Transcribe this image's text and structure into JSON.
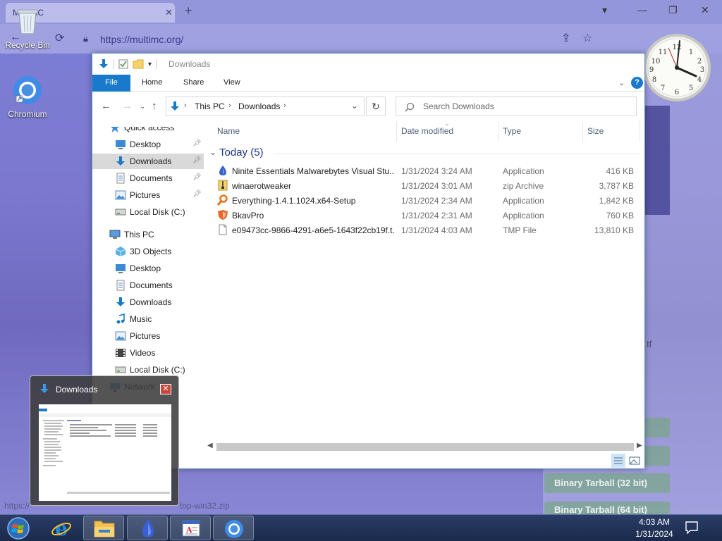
{
  "browser": {
    "tab_title": "MultiMC",
    "url": "https://multimc.org/",
    "status_url": "https://",
    "status_url_tail": "top-win32.zip",
    "buttons": [
      "Binary Tarball (32 bit)",
      "Binary Tarball (64 bit)"
    ],
    "partial_text": "If"
  },
  "desktop": {
    "icons": [
      {
        "label": "Recycle Bin",
        "icon": "recycle-bin-icon"
      },
      {
        "label": "Chromium",
        "icon": "chromium-icon"
      }
    ]
  },
  "explorer": {
    "title": "Downloads",
    "ribbon_tabs": [
      "File",
      "Home",
      "Share",
      "View"
    ],
    "breadcrumb": [
      "This PC",
      "Downloads"
    ],
    "search_placeholder": "Search Downloads",
    "columns": [
      "Name",
      "Date modified",
      "Type",
      "Size"
    ],
    "group": "Today (5)",
    "nav": [
      {
        "label": "Quick access",
        "icon": "star-icon",
        "level": 0,
        "pinned": false
      },
      {
        "label": "Desktop",
        "icon": "desktop-folder-icon",
        "level": 1,
        "pinned": true
      },
      {
        "label": "Downloads",
        "icon": "downloads-icon",
        "level": 1,
        "pinned": true,
        "selected": true
      },
      {
        "label": "Documents",
        "icon": "documents-icon",
        "level": 1,
        "pinned": true
      },
      {
        "label": "Pictures",
        "icon": "pictures-icon",
        "level": 1,
        "pinned": true
      },
      {
        "label": "Local Disk (C:)",
        "icon": "drive-icon",
        "level": 1,
        "pinned": false
      },
      {
        "label": "This PC",
        "icon": "computer-icon",
        "level": 0,
        "pinned": false
      },
      {
        "label": "3D Objects",
        "icon": "3d-objects-icon",
        "level": 1,
        "pinned": false
      },
      {
        "label": "Desktop",
        "icon": "desktop-folder-icon",
        "level": 1,
        "pinned": false
      },
      {
        "label": "Documents",
        "icon": "documents-icon",
        "level": 1,
        "pinned": false
      },
      {
        "label": "Downloads",
        "icon": "downloads-icon",
        "level": 1,
        "pinned": false
      },
      {
        "label": "Music",
        "icon": "music-icon",
        "level": 1,
        "pinned": false
      },
      {
        "label": "Pictures",
        "icon": "pictures-icon",
        "level": 1,
        "pinned": false
      },
      {
        "label": "Videos",
        "icon": "videos-icon",
        "level": 1,
        "pinned": false
      },
      {
        "label": "Local Disk (C:)",
        "icon": "drive-icon",
        "level": 1,
        "pinned": false
      },
      {
        "label": "Network",
        "icon": "network-icon",
        "level": 0,
        "pinned": false
      }
    ],
    "files": [
      {
        "name": "Ninite Essentials Malwarebytes Visual Stu...",
        "date": "1/31/2024 3:24 AM",
        "type": "Application",
        "size": "416 KB",
        "icon": "ninite-icon"
      },
      {
        "name": "winaerotweaker",
        "date": "1/31/2024 3:01 AM",
        "type": "zip Archive",
        "size": "3,787 KB",
        "icon": "zip-archive-icon"
      },
      {
        "name": "Everything-1.4.1.1024.x64-Setup",
        "date": "1/31/2024 2:34 AM",
        "type": "Application",
        "size": "1,842 KB",
        "icon": "everything-search-icon"
      },
      {
        "name": "BkavPro",
        "date": "1/31/2024 2:31 AM",
        "type": "Application",
        "size": "760 KB",
        "icon": "bkav-shield-icon"
      },
      {
        "name": "e09473cc-9866-4291-a6e5-1643f22cb19f.t...",
        "date": "1/31/2024 4:03 AM",
        "type": "TMP File",
        "size": "13,810 KB",
        "icon": "blank-file-icon"
      }
    ]
  },
  "thumbnail": {
    "title": "Downloads"
  },
  "taskbar": {
    "items": [
      "start-orb-icon",
      "internet-explorer-icon",
      "file-explorer-icon",
      "ninite-icon",
      "wordpad-icon",
      "chromium-icon"
    ],
    "time": "4:03 AM",
    "date": "1/31/2024"
  },
  "colors": {
    "accent": "#1979ca",
    "group_header": "#1e3287",
    "selection": "#d9d9d9"
  }
}
